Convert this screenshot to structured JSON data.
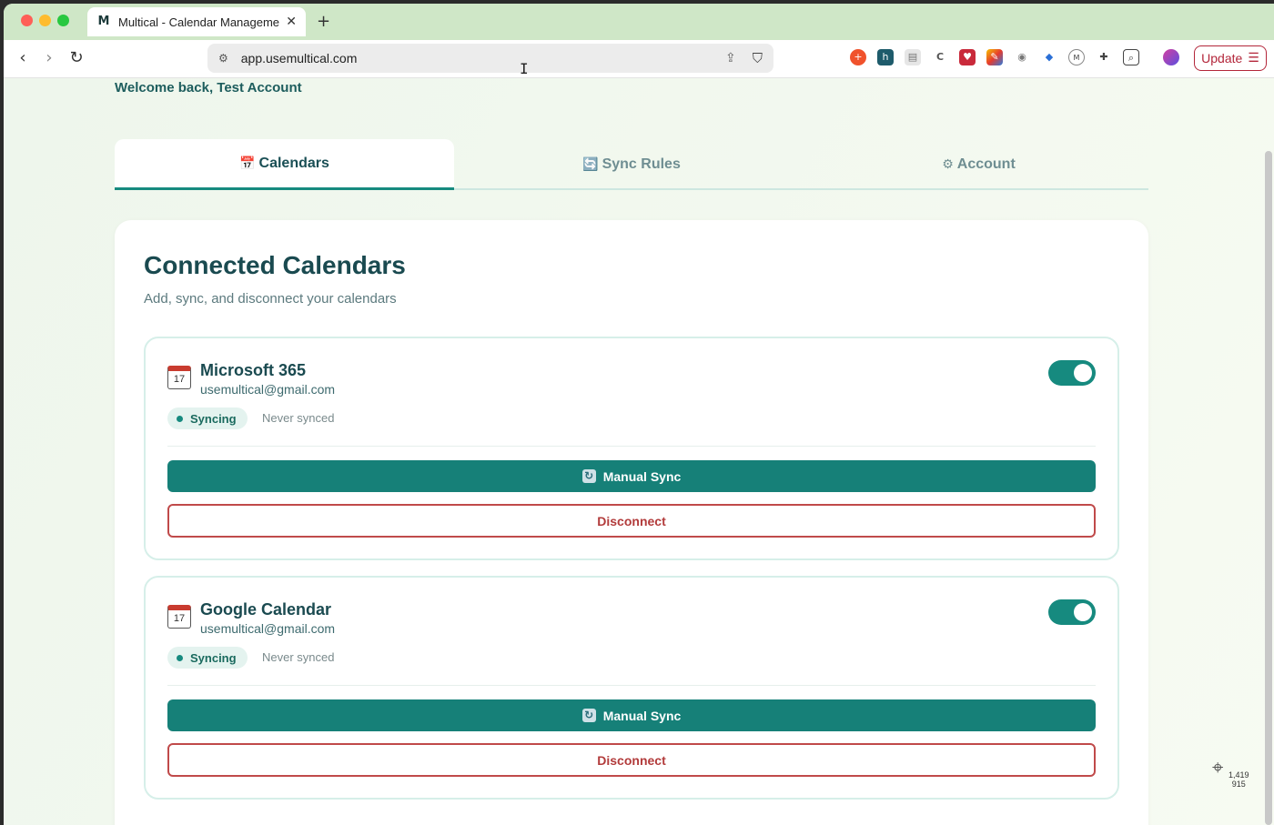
{
  "browser": {
    "tab_title": "Multical - Calendar Manageme",
    "tab_favicon": "M",
    "tab_close": "✕",
    "new_tab": "+",
    "url": "app.usemultical.com",
    "update_label": "Update",
    "nav": {
      "back": "‹",
      "forward": "›",
      "reload": "↻"
    },
    "icons": [
      "site-settings-icon",
      "share-icon",
      "brave-shield-icon",
      "menu-icon"
    ]
  },
  "page": {
    "welcome": "Welcome back, Test Account",
    "tabs": [
      {
        "label": "Calendars",
        "icon": "📅",
        "active": true
      },
      {
        "label": "Sync Rules",
        "icon": "🔄",
        "active": false
      },
      {
        "label": "Account",
        "icon": "⚙",
        "active": false
      }
    ],
    "section_title": "Connected Calendars",
    "section_subtitle": "Add, sync, and disconnect your calendars",
    "calendars": [
      {
        "name": "Microsoft 365",
        "email": "usemultical@gmail.com",
        "status": "Syncing",
        "last_synced": "Never synced",
        "enabled": true,
        "icon_day": "17",
        "sync_label": "Manual Sync",
        "disconnect_label": "Disconnect"
      },
      {
        "name": "Google Calendar",
        "email": "usemultical@gmail.com",
        "status": "Syncing",
        "last_synced": "Never synced",
        "enabled": true,
        "icon_day": "17",
        "sync_label": "Manual Sync",
        "disconnect_label": "Disconnect"
      }
    ],
    "accent_color": "#168a7f",
    "danger_color": "#c04a4a"
  },
  "overlay": {
    "coord_x": "1,419",
    "coord_y": "915"
  }
}
